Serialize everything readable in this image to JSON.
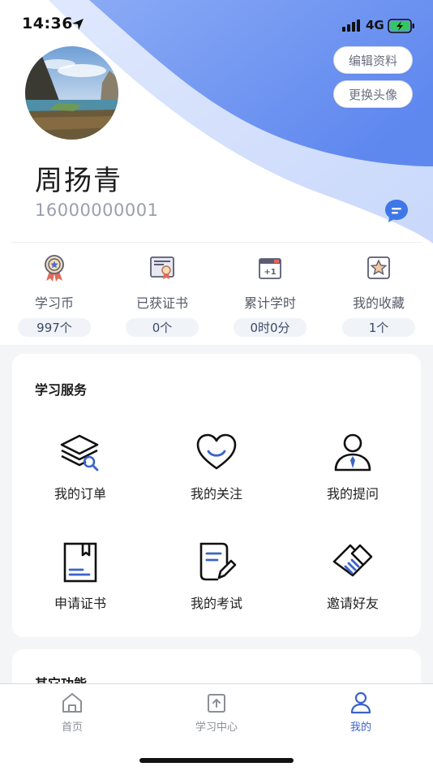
{
  "status_bar": {
    "time": "14:36",
    "network": "4G"
  },
  "header": {
    "edit_profile": "编辑资料",
    "change_avatar": "更换头像"
  },
  "user": {
    "name": "周扬青",
    "phone": "16000000001"
  },
  "stats": [
    {
      "label": "学习币",
      "value": "997个",
      "icon": "medal-icon"
    },
    {
      "label": "已获证书",
      "value": "0个",
      "icon": "certificate-icon"
    },
    {
      "label": "累计学时",
      "value": "0时0分",
      "icon": "calendar-icon"
    },
    {
      "label": "我的收藏",
      "value": "1个",
      "icon": "star-icon"
    }
  ],
  "services": {
    "title": "学习服务",
    "items": [
      {
        "label": "我的订单",
        "icon": "order-layers-icon"
      },
      {
        "label": "我的关注",
        "icon": "heart-icon"
      },
      {
        "label": "我的提问",
        "icon": "person-tie-icon"
      },
      {
        "label": "申请证书",
        "icon": "book-icon"
      },
      {
        "label": "我的考试",
        "icon": "exam-paper-icon"
      },
      {
        "label": "邀请好友",
        "icon": "handshake-icon"
      }
    ]
  },
  "other": {
    "title": "其它功能"
  },
  "tabbar": {
    "items": [
      {
        "label": "首页",
        "icon": "home-icon"
      },
      {
        "label": "学习中心",
        "icon": "learning-center-icon"
      },
      {
        "label": "我的",
        "icon": "user-icon"
      }
    ],
    "active": "我的"
  },
  "colors": {
    "accent": "#3b63c9",
    "hero_blue": "#6f95f2",
    "icon_dark": "#111111"
  }
}
